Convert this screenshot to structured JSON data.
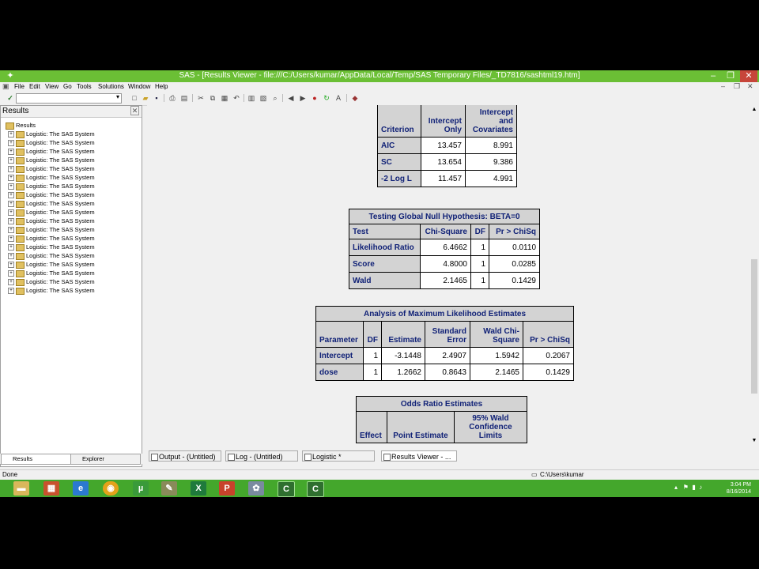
{
  "window": {
    "title": "SAS - [Results Viewer - file:///C:/Users/kumar/AppData/Local/Temp/SAS Temporary Files/_TD7816/sashtml19.htm]"
  },
  "menu": [
    "File",
    "Edit",
    "View",
    "Go",
    "Tools",
    "Solutions",
    "Window",
    "Help"
  ],
  "results_pane": {
    "title": "Results",
    "root": "Results",
    "item_label": "Logistic:  The SAS System",
    "tabs": [
      "Results",
      "Explorer"
    ]
  },
  "tables": {
    "fit": {
      "headers": [
        "Criterion",
        "Intercept Only",
        "Intercept and Covariates"
      ],
      "rows": [
        [
          "AIC",
          "13.457",
          "8.991"
        ],
        [
          "SC",
          "13.654",
          "9.386"
        ],
        [
          "-2 Log L",
          "11.457",
          "4.991"
        ]
      ]
    },
    "global": {
      "title": "Testing Global Null Hypothesis: BETA=0",
      "headers": [
        "Test",
        "Chi-Square",
        "DF",
        "Pr > ChiSq"
      ],
      "rows": [
        [
          "Likelihood Ratio",
          "6.4662",
          "1",
          "0.0110"
        ],
        [
          "Score",
          "4.8000",
          "1",
          "0.0285"
        ],
        [
          "Wald",
          "2.1465",
          "1",
          "0.1429"
        ]
      ]
    },
    "mle": {
      "title": "Analysis of Maximum Likelihood Estimates",
      "headers": [
        "Parameter",
        "DF",
        "Estimate",
        "Standard Error",
        "Wald Chi-Square",
        "Pr > ChiSq"
      ],
      "rows": [
        [
          "Intercept",
          "1",
          "-3.1448",
          "2.4907",
          "1.5942",
          "0.2067"
        ],
        [
          "dose",
          "1",
          "1.2662",
          "0.8643",
          "2.1465",
          "0.1429"
        ]
      ]
    },
    "odds": {
      "title": "Odds Ratio Estimates",
      "headers": [
        "Effect",
        "Point Estimate",
        "95% Wald Confidence Limits"
      ]
    }
  },
  "window_tabs": [
    "Output - (Untitled)",
    "Log - (Untitled)",
    "Logistic *",
    "Results Viewer - ..."
  ],
  "status": {
    "left": "Done",
    "path": "C:\\Users\\kumar"
  },
  "tray": {
    "time": "3:04 PM",
    "date": "8/16/2014"
  }
}
